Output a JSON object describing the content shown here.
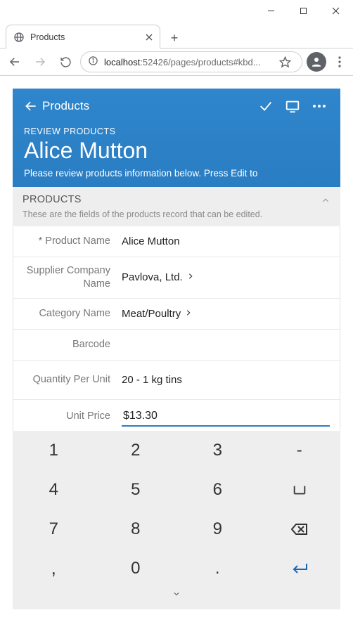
{
  "browser": {
    "tab_title": "Products",
    "url_host": "localhost",
    "url_port_path": ":52426/pages/products#kbd..."
  },
  "app_header": {
    "back_label": "Products",
    "review_label": "REVIEW PRODUCTS",
    "title": "Alice Mutton",
    "hint": "Please review products information below. Press Edit to"
  },
  "section": {
    "title": "PRODUCTS",
    "desc": "These are the fields of the products record that can be edited."
  },
  "fields": {
    "product_name": {
      "label": "* Product Name",
      "value": "Alice Mutton"
    },
    "supplier": {
      "label": "Supplier Company Name",
      "value": "Pavlova, Ltd."
    },
    "category": {
      "label": "Category Name",
      "value": "Meat/Poultry"
    },
    "barcode": {
      "label": "Barcode",
      "value": ""
    },
    "qty_per_unit": {
      "label": "Quantity Per Unit",
      "value": "20 - 1 kg tins"
    },
    "unit_price": {
      "label": "Unit Price",
      "value": "$13.30"
    }
  },
  "keypad": {
    "k1": "1",
    "k2": "2",
    "k3": "3",
    "kdash": "-",
    "k4": "4",
    "k5": "5",
    "k6": "6",
    "k7": "7",
    "k8": "8",
    "k9": "9",
    "kcomma": ",",
    "k0": "0",
    "kdot": "."
  }
}
